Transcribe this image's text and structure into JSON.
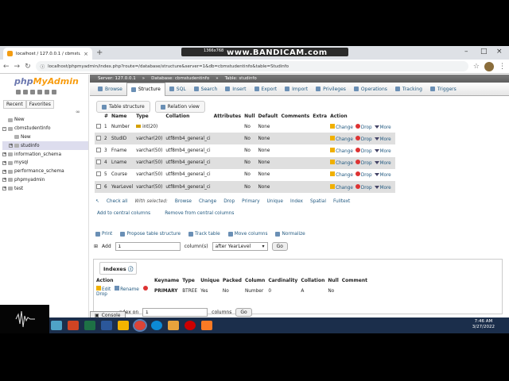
{
  "browser": {
    "tab_title": "localhost / 127.0.0.1 / cbmstud",
    "url": "localhost/phpmyadmin/index.php?route=/database/structure&server=1&db=cbmstudentinfo&table=Studinfo",
    "recorder": "www.BANDICAM.com",
    "recorder_res": "1366x768"
  },
  "pma": {
    "logo_a": "php",
    "logo_b": "MyAdmin",
    "left_tabs": [
      "Recent",
      "Favorites"
    ],
    "tree": [
      {
        "label": "New",
        "level": 0,
        "toggle": ""
      },
      {
        "label": "cbmstudentinfo",
        "level": 0,
        "toggle": "-"
      },
      {
        "label": "New",
        "level": 1,
        "toggle": ""
      },
      {
        "label": "studinfo",
        "level": 1,
        "toggle": "+"
      },
      {
        "label": "information_schema",
        "level": 0,
        "toggle": "+"
      },
      {
        "label": "mysql",
        "level": 0,
        "toggle": "+"
      },
      {
        "label": "performance_schema",
        "level": 0,
        "toggle": "+"
      },
      {
        "label": "phpmyadmin",
        "level": 0,
        "toggle": "+"
      },
      {
        "label": "test",
        "level": 0,
        "toggle": "+"
      }
    ],
    "breadcrumb": [
      "Server: 127.0.0.1",
      "Database: cbmstudentinfo",
      "Table: studinfo"
    ],
    "menu": [
      "Browse",
      "Structure",
      "SQL",
      "Search",
      "Insert",
      "Export",
      "Import",
      "Privileges",
      "Operations",
      "Tracking",
      "Triggers"
    ],
    "subtabs": [
      "Table structure",
      "Relation view"
    ],
    "columns_header": [
      "#",
      "Name",
      "Type",
      "Collation",
      "Attributes",
      "Null",
      "Default",
      "Comments",
      "Extra",
      "Action"
    ],
    "rows": [
      {
        "num": "1",
        "name": "Number",
        "type": "int(20)",
        "collation": "",
        "null": "No",
        "default": "None",
        "key": true
      },
      {
        "num": "2",
        "name": "StudID",
        "type": "varchar(20)",
        "collation": "utf8mb4_general_ci",
        "null": "No",
        "default": "None"
      },
      {
        "num": "3",
        "name": "Fname",
        "type": "varchar(50)",
        "collation": "utf8mb4_general_ci",
        "null": "No",
        "default": "None"
      },
      {
        "num": "4",
        "name": "Lname",
        "type": "varchar(50)",
        "collation": "utf8mb4_general_ci",
        "null": "No",
        "default": "None"
      },
      {
        "num": "5",
        "name": "Course",
        "type": "varchar(50)",
        "collation": "utf8mb4_general_ci",
        "null": "No",
        "default": "None"
      },
      {
        "num": "6",
        "name": "YearLevel",
        "type": "varchar(50)",
        "collation": "utf8mb4_general_ci",
        "null": "No",
        "default": "None"
      }
    ],
    "row_actions": [
      "Change",
      "Drop",
      "More"
    ],
    "with_selected": [
      "Check all",
      "With selected:",
      "Browse",
      "Change",
      "Drop",
      "Primary",
      "Unique",
      "Index",
      "Spatial",
      "Fulltext"
    ],
    "central": [
      "Add to central columns",
      "Remove from central columns"
    ],
    "links2": [
      "Print",
      "Propose table structure",
      "Track table",
      "Move columns",
      "Normalize"
    ],
    "add_label": "Add",
    "add_value": "1",
    "add_suffix": "column(s)",
    "add_select": "after YearLevel",
    "go": "Go",
    "indexes_title": "Indexes",
    "idx_header": [
      "Action",
      "Keyname",
      "Type",
      "Unique",
      "Packed",
      "Column",
      "Cardinality",
      "Collation",
      "Null",
      "Comment"
    ],
    "idx_row": {
      "edit": "Edit",
      "rename": "Rename",
      "drop": "Drop",
      "keyname": "PRIMARY",
      "type": "BTREE",
      "unique": "Yes",
      "packed": "No",
      "column": "Number",
      "cardinality": "0",
      "collation": "A",
      "null": "No",
      "comment": ""
    },
    "console": "Console",
    "create_idx_label": "ndex on",
    "create_idx_value": "1",
    "create_idx_suffix": "columns",
    "create_go": "Go"
  },
  "clock": {
    "time": "7:46 AM",
    "date": "3/27/2022"
  }
}
